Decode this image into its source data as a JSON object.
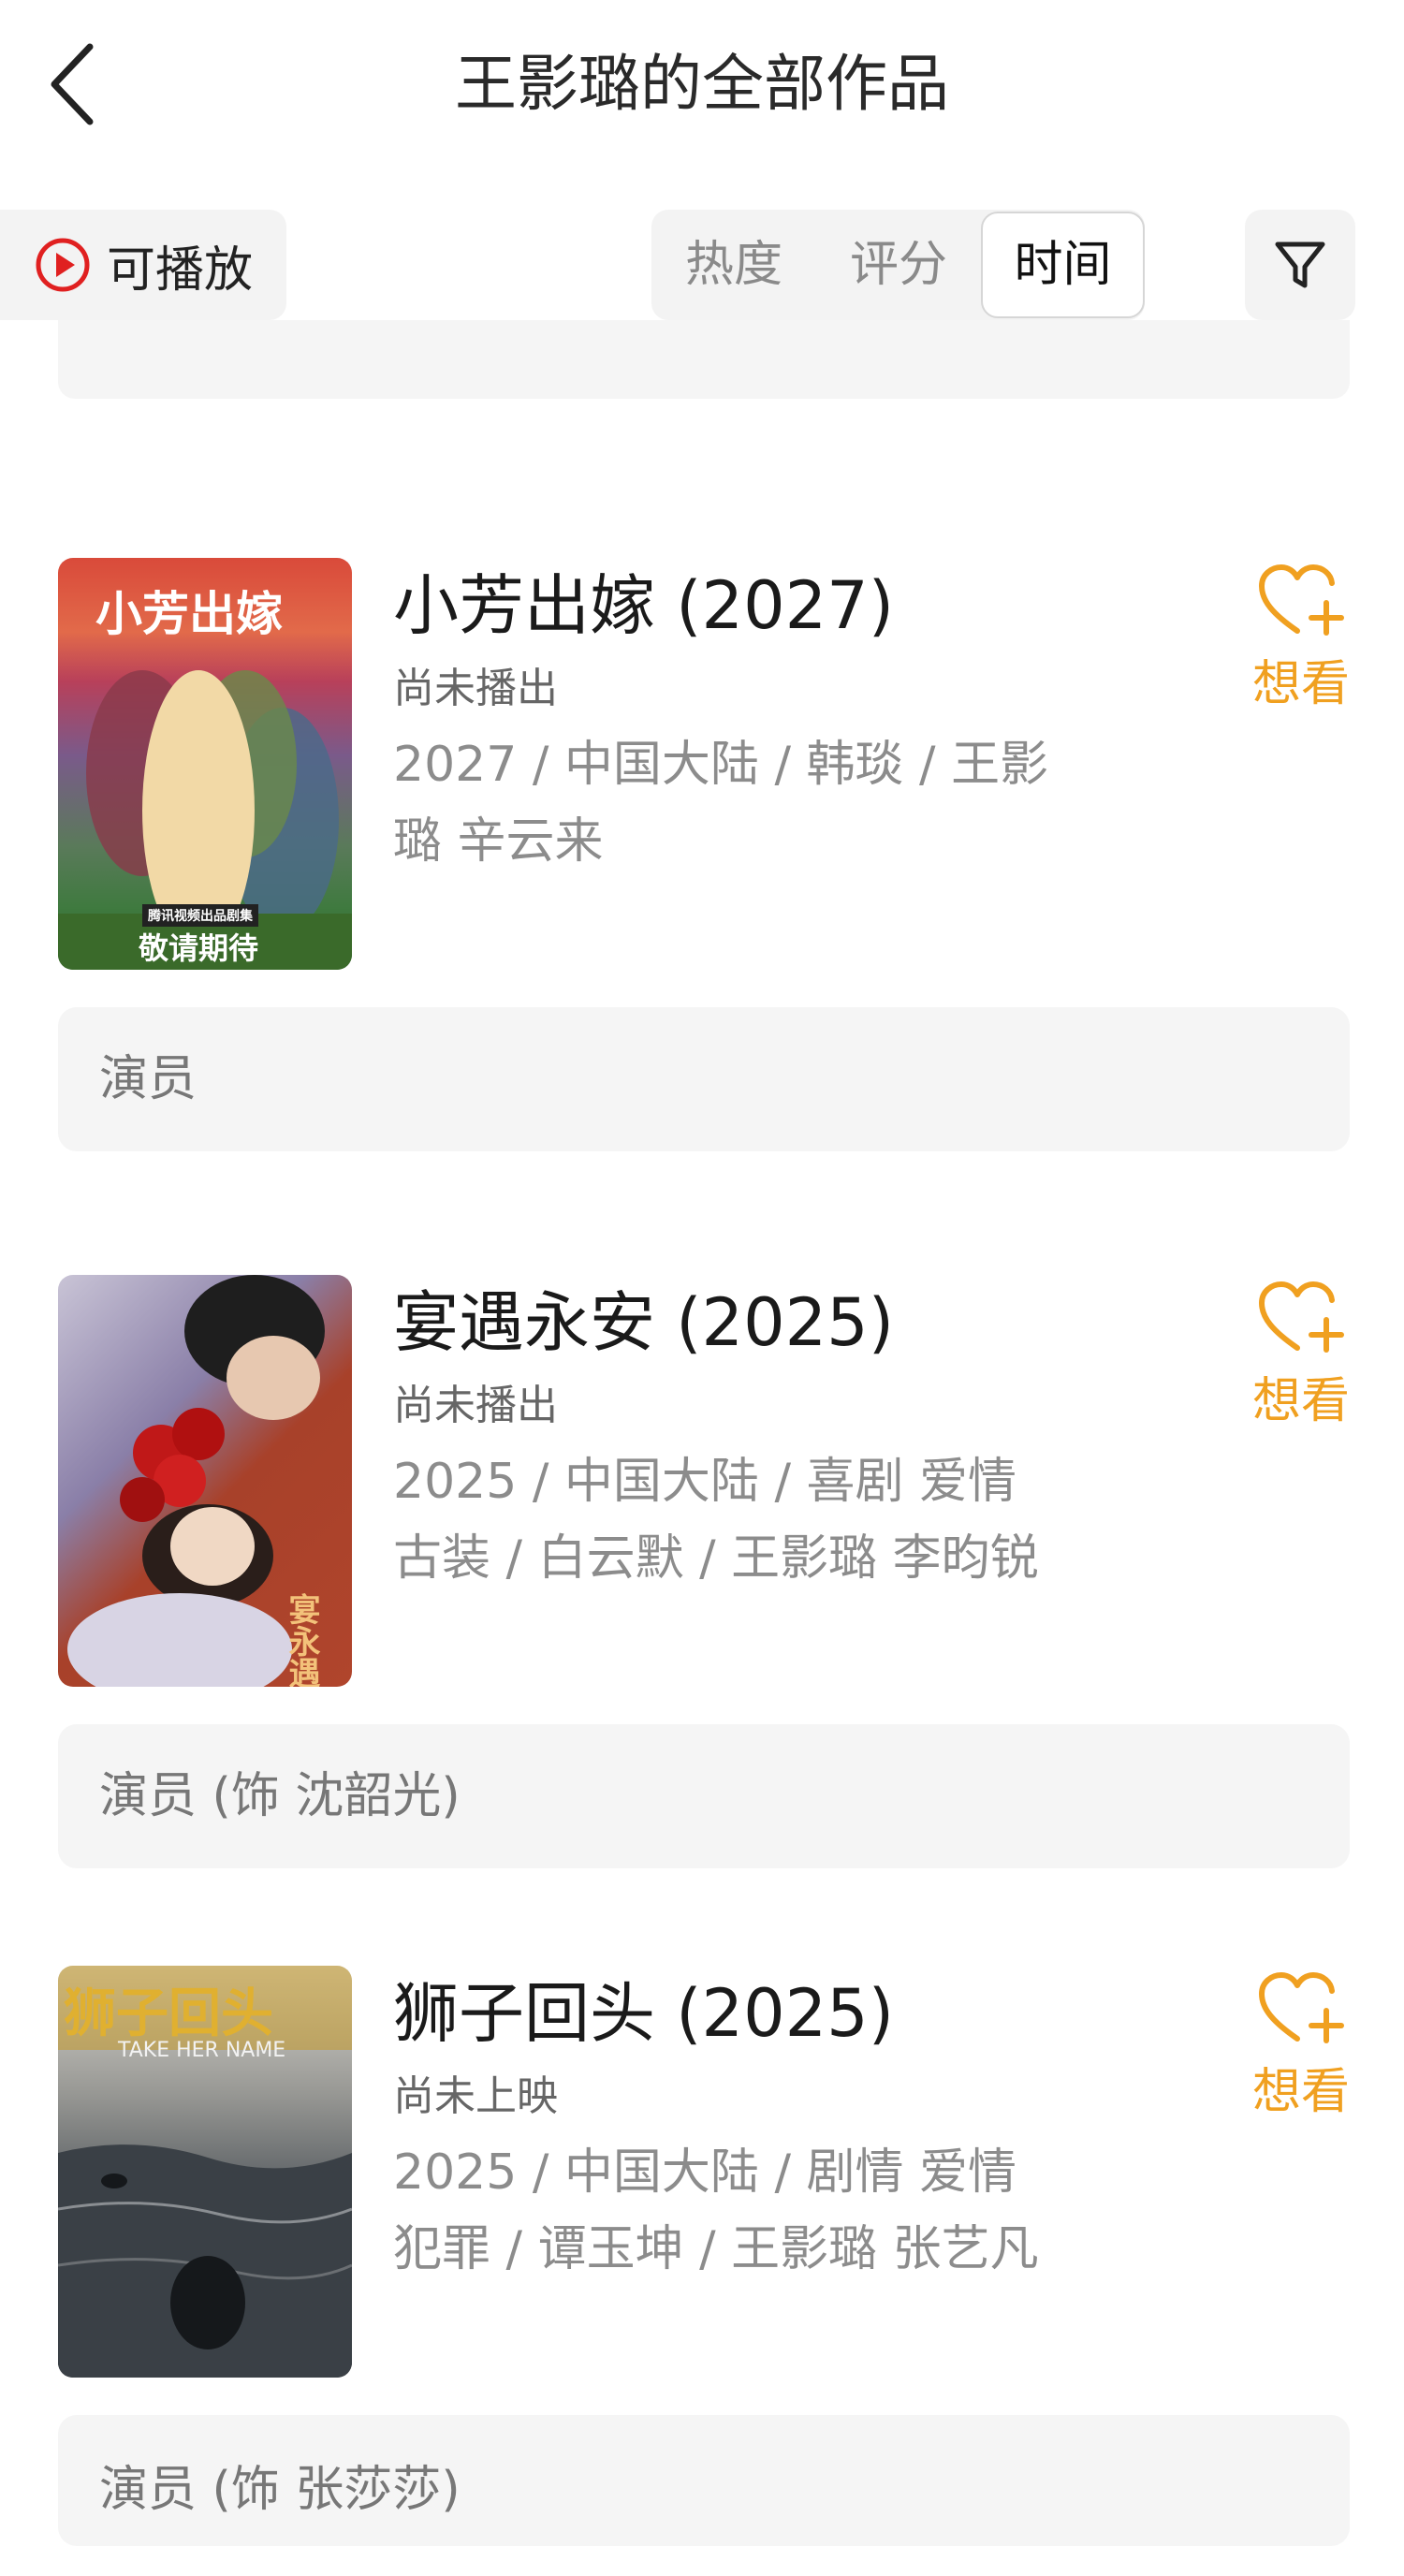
{
  "header": {
    "title": "王影璐的全部作品"
  },
  "toolbar": {
    "playable_label": "可播放",
    "sort_tabs": [
      "热度",
      "评分",
      "时间"
    ],
    "active_sort": "时间"
  },
  "works": [
    {
      "title": "小芳出嫁 (2027)",
      "status": "尚未播出",
      "meta_line1": "2027 / 中国大陆 / 韩琰 / 王影",
      "meta_line2": "璐 辛云来",
      "want_label": "想看",
      "role": "演员",
      "poster": {
        "title_text": "小芳出嫁",
        "badge_text": "腾讯视频出品剧集",
        "footer_text": "敬请期待"
      }
    },
    {
      "title": "宴遇永安 (2025)",
      "status": "尚未播出",
      "meta_line1": "2025 / 中国大陆 / 喜剧 爱情",
      "meta_line2": "古装 / 白云默 / 王影璐 李昀锐",
      "want_label": "想看",
      "role": "演员 (饰 沈韶光)",
      "poster": {
        "title_text": "宴永遇安"
      }
    },
    {
      "title": "狮子回头 (2025)",
      "status": "尚未上映",
      "meta_line1": "2025 / 中国大陆 / 剧情 爱情",
      "meta_line2": "犯罪 / 谭玉坤 / 王影璐 张艺凡",
      "want_label": "想看",
      "role": "演员 (饰 张莎莎)",
      "poster": {
        "title_text": "狮子回头",
        "subtitle_text": "TAKE HER NAME"
      }
    }
  ],
  "colors": {
    "accent": "#f0a020",
    "play_red": "#e02020",
    "card_bg": "#f5f5f5"
  },
  "icons": {
    "back": "chevron-left-icon",
    "play": "play-circle-icon",
    "filter": "funnel-icon",
    "want": "heart-plus-icon"
  }
}
